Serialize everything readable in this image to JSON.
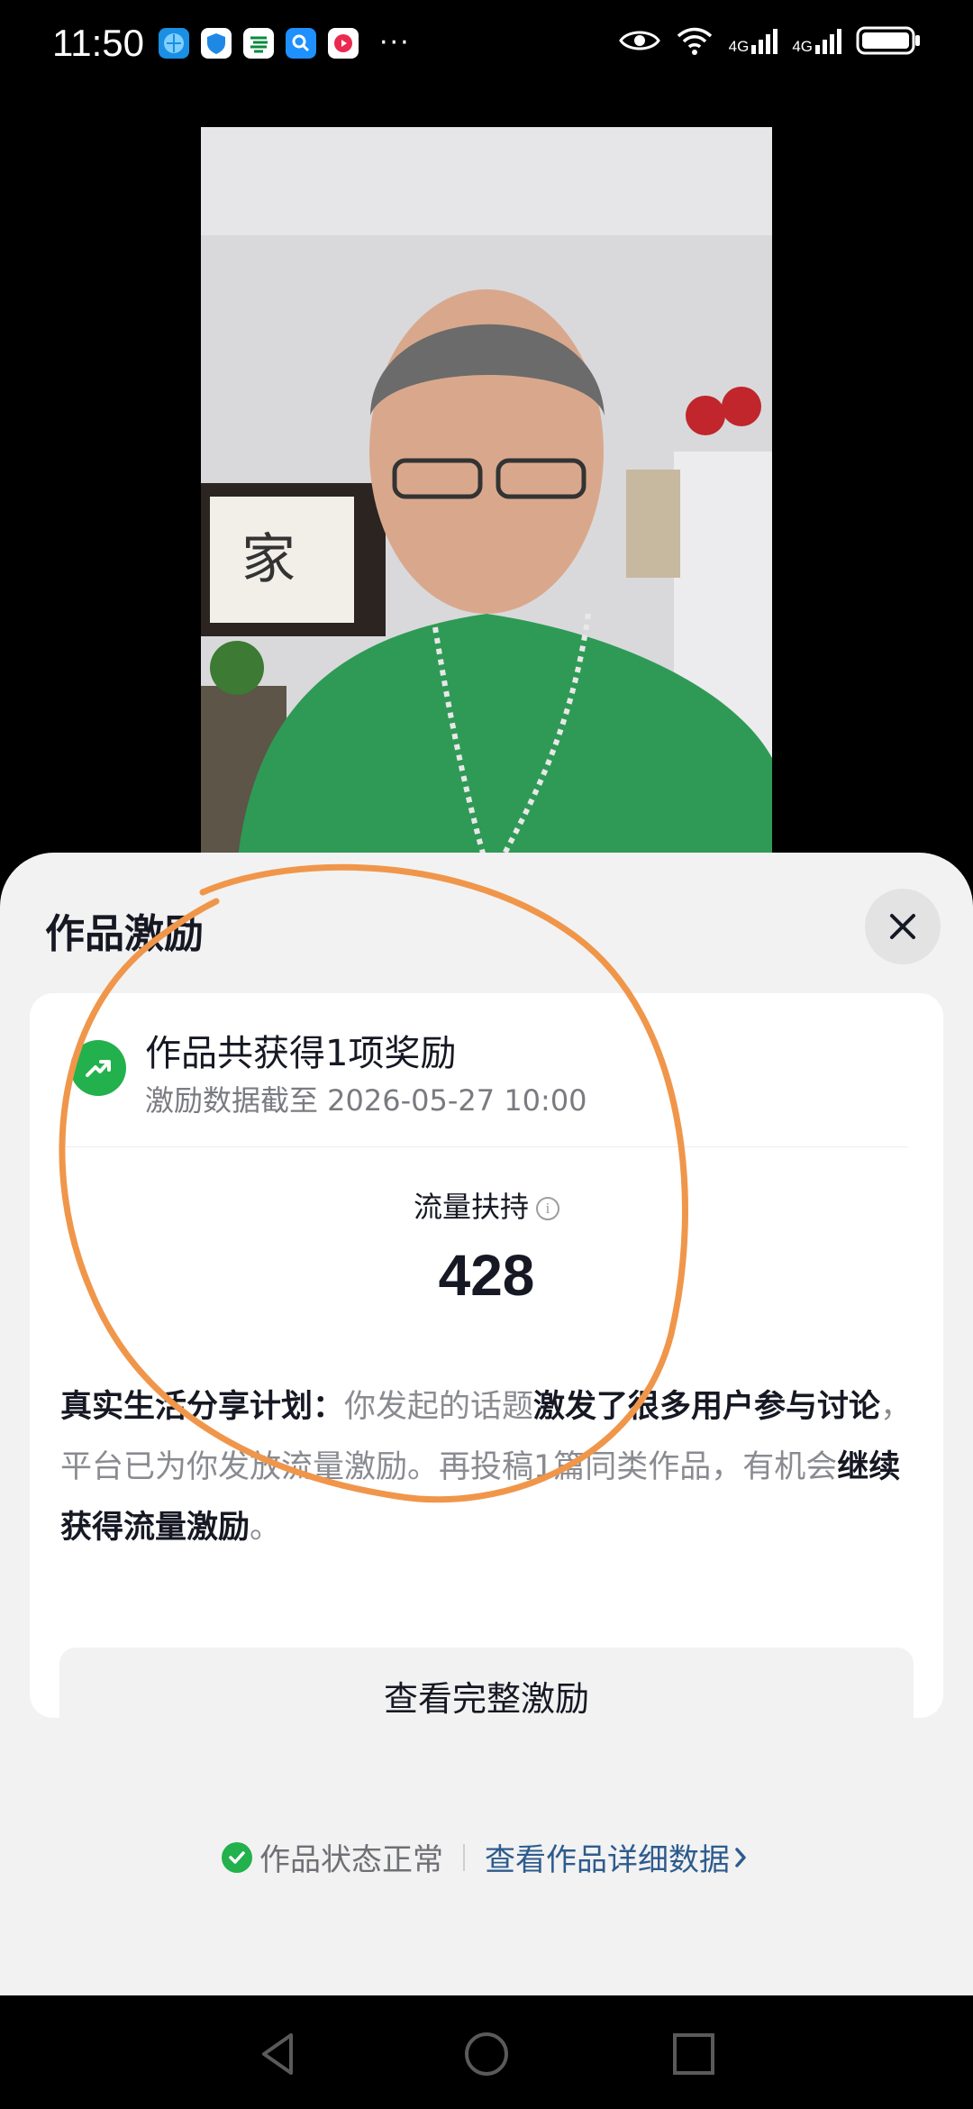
{
  "status_bar": {
    "time": "11:50",
    "network_1": "4G",
    "network_2": "4G",
    "more": "···"
  },
  "sheet": {
    "title": "作品激励",
    "card": {
      "heading": "作品共获得1项奖励",
      "subtitle": "激励数据截至 2026-05-27 10:00",
      "metric_label": "流量扶持",
      "metric_value": "428",
      "desc_prefix": "真实生活分享计划：",
      "desc_1": "你发起的话题",
      "desc_bold_1": "激发了很多用户参与讨论",
      "desc_2": "，平台已为你发放流量激励。再投稿1篇同类作品，有机会",
      "desc_bold_2": "继续获得流量激励",
      "desc_3": "。",
      "button_label": "查看完整激励"
    },
    "footer": {
      "status": "作品状态正常",
      "link": "查看作品详细数据"
    }
  },
  "colors": {
    "accent_green": "#22b14c",
    "link_blue": "#2d5b8e",
    "annotation_orange": "#f0964a"
  }
}
